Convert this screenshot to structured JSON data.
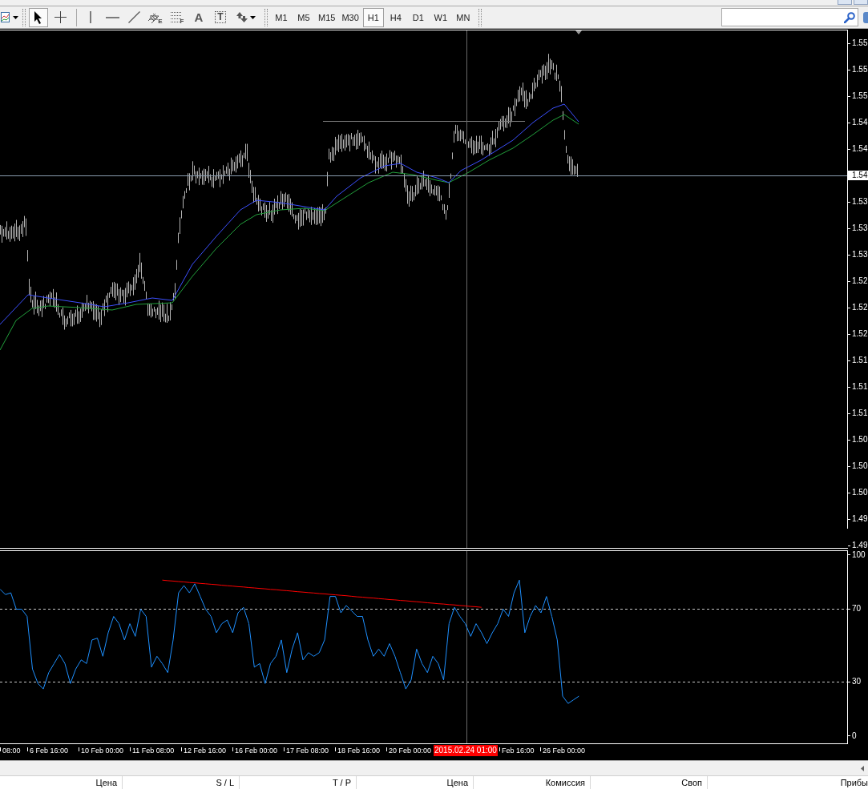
{
  "toolbar": {
    "tools": [
      {
        "kind": "cursor",
        "selected": true
      },
      {
        "kind": "crosshair",
        "selected": false
      },
      {
        "kind": "vertical-line",
        "selected": false
      },
      {
        "kind": "horizontal-line",
        "selected": false
      },
      {
        "kind": "trendline",
        "selected": false
      },
      {
        "kind": "channel",
        "label": "E",
        "selected": false
      },
      {
        "kind": "fibonacci",
        "label": "F",
        "selected": false
      },
      {
        "kind": "text",
        "label": "A",
        "selected": false
      },
      {
        "kind": "text-label",
        "label": "T",
        "selected": false
      },
      {
        "kind": "arrows",
        "selected": false
      }
    ],
    "timeframes": [
      {
        "label": "M1",
        "selected": false
      },
      {
        "label": "M5",
        "selected": false
      },
      {
        "label": "M15",
        "selected": false
      },
      {
        "label": "M30",
        "selected": false
      },
      {
        "label": "H1",
        "selected": true
      },
      {
        "label": "H4",
        "selected": false
      },
      {
        "label": "D1",
        "selected": false
      },
      {
        "label": "W1",
        "selected": false
      },
      {
        "label": "MN",
        "selected": false
      }
    ]
  },
  "chart": {
    "price_axis": [
      {
        "kind": "tick",
        "label": "1.55"
      },
      {
        "kind": "tick",
        "label": "1.55"
      },
      {
        "kind": "tick",
        "label": "1.55"
      },
      {
        "kind": "tick",
        "label": "1.54"
      },
      {
        "kind": "tick",
        "label": "1.54"
      },
      {
        "kind": "current",
        "label": "1.54"
      },
      {
        "kind": "tick",
        "label": "1.53"
      },
      {
        "kind": "tick",
        "label": "1.53"
      },
      {
        "kind": "tick",
        "label": "1.53"
      },
      {
        "kind": "tick",
        "label": "1.52"
      },
      {
        "kind": "tick",
        "label": "1.52"
      },
      {
        "kind": "tick",
        "label": "1.52"
      },
      {
        "kind": "tick",
        "label": "1.51"
      },
      {
        "kind": "tick",
        "label": "1.51"
      },
      {
        "kind": "tick",
        "label": "1.51"
      },
      {
        "kind": "tick",
        "label": "1.50"
      },
      {
        "kind": "tick",
        "label": "1.50"
      },
      {
        "kind": "tick",
        "label": "1.50"
      },
      {
        "kind": "tick",
        "label": "1.49"
      },
      {
        "kind": "tick",
        "label": "1.49"
      }
    ],
    "rsi": {
      "chart_data": {
        "type": "line",
        "ylim": [
          -4,
          102
        ],
        "yticks": [
          0,
          30,
          70,
          100
        ],
        "series": [
          {
            "color": "#1e90ff",
            "values": [
              81,
              78,
              79,
              70,
              70,
              66,
              37,
              29,
              26,
              35,
              40,
              45,
              40,
              29,
              37,
              42,
              40,
              53,
              54,
              44,
              57,
              66,
              62,
              53,
              62,
              55,
              70,
              66,
              38,
              44,
              40,
              35,
              53,
              79,
              83,
              79,
              84,
              77,
              70,
              66,
              57,
              62,
              64,
              57,
              68,
              71,
              62,
              38,
              40,
              29,
              40,
              44,
              53,
              35,
              48,
              57,
              42,
              46,
              44,
              46,
              53,
              77,
              77,
              68,
              72,
              69,
              66,
              66,
              53,
              44,
              48,
              44,
              51,
              44,
              35,
              26,
              31,
              48,
              40,
              35,
              44,
              40,
              31,
              62,
              71,
              66,
              62,
              55,
              62,
              57,
              51,
              57,
              62,
              70,
              66,
              79,
              86,
              57,
              66,
              72,
              68,
              77,
              66,
              53,
              22,
              18,
              20,
              22
            ]
          },
          {
            "color": "#ff0000",
            "values": [
              null,
              null,
              null,
              null,
              null,
              null,
              null,
              null,
              null,
              null,
              null,
              null,
              null,
              null,
              null,
              null,
              null,
              null,
              null,
              null,
              null,
              null,
              null,
              null,
              null,
              null,
              null,
              null,
              null,
              null,
              86.0,
              85.7,
              85.5,
              85.2,
              85.0,
              84.7,
              84.5,
              84.2,
              84.0,
              83.7,
              83.5,
              83.2,
              82.9,
              82.7,
              82.4,
              82.2,
              81.9,
              81.7,
              81.4,
              81.2,
              80.9,
              80.7,
              80.4,
              80.2,
              79.9,
              79.6,
              79.4,
              79.1,
              78.9,
              78.6,
              78.4,
              78.1,
              77.9,
              77.6,
              77.4,
              77.1,
              76.8,
              76.6,
              76.3,
              76.1,
              75.8,
              75.6,
              75.3,
              75.1,
              74.8,
              74.6,
              74.3,
              74.1,
              73.8,
              73.5,
              73.3,
              73.0,
              72.8,
              72.5,
              72.3,
              72.0,
              71.8,
              71.5,
              71.3,
              71.0
            ]
          }
        ]
      }
    },
    "time_axis": [
      "08:00",
      "6 Feb 16:00",
      "10 Feb 00:00",
      "11 Feb 08:00",
      "12 Feb 16:00",
      "16 Feb 00:00",
      "17 Feb 08:00",
      "18 Feb 16:00",
      "20 Feb 00:00",
      "Feb 16:00",
      "26 Feb 00:00"
    ],
    "crosshair_time": "2015.02.24 01:00"
  },
  "terminal": {
    "columns": [
      "Цена",
      "S / L",
      "T / P",
      "Цена",
      "Комиссия",
      "Своп",
      "Прибы"
    ]
  }
}
